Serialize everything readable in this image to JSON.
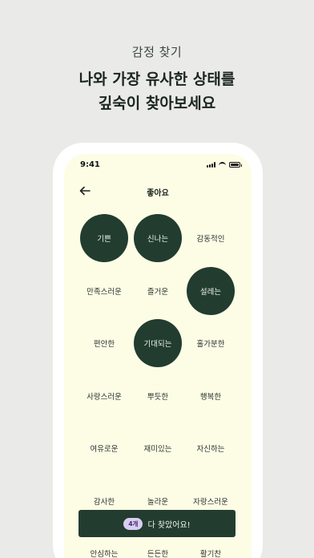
{
  "promo": {
    "top_label": "감정 찾기",
    "headline_line1": "나와 가장 유사한 상태를",
    "headline_line2": "깊숙이 찾아보세요"
  },
  "status_bar": {
    "time": "9:41",
    "battery_level": 1.0
  },
  "header": {
    "title": "좋아요",
    "back_icon": "arrow-left-icon"
  },
  "emotions": [
    {
      "label": "기쁜",
      "selected": true
    },
    {
      "label": "신나는",
      "selected": true
    },
    {
      "label": "감동적인",
      "selected": false
    },
    {
      "label": "만족스러운",
      "selected": false
    },
    {
      "label": "즐거운",
      "selected": false
    },
    {
      "label": "설레는",
      "selected": true
    },
    {
      "label": "편안한",
      "selected": false
    },
    {
      "label": "기대되는",
      "selected": true
    },
    {
      "label": "홀가분한",
      "selected": false
    },
    {
      "label": "사랑스러운",
      "selected": false
    },
    {
      "label": "뿌듯한",
      "selected": false
    },
    {
      "label": "행복한",
      "selected": false
    },
    {
      "label": "여유로운",
      "selected": false
    },
    {
      "label": "재미있는",
      "selected": false
    },
    {
      "label": "자신하는",
      "selected": false
    },
    {
      "label": "감사한",
      "selected": false
    },
    {
      "label": "놀라운",
      "selected": false
    },
    {
      "label": "자랑스러운",
      "selected": false
    },
    {
      "label": "안심하는",
      "selected": false
    },
    {
      "label": "든든한",
      "selected": false
    },
    {
      "label": "활기찬",
      "selected": false
    }
  ],
  "cta": {
    "count_badge": "4개",
    "label": "다 찾았어요!"
  },
  "colors": {
    "accent_dark_green": "#223c2f",
    "screen_background": "#fdfde6",
    "badge_background": "#d9cdf1",
    "page_background": "#eaeae8"
  }
}
